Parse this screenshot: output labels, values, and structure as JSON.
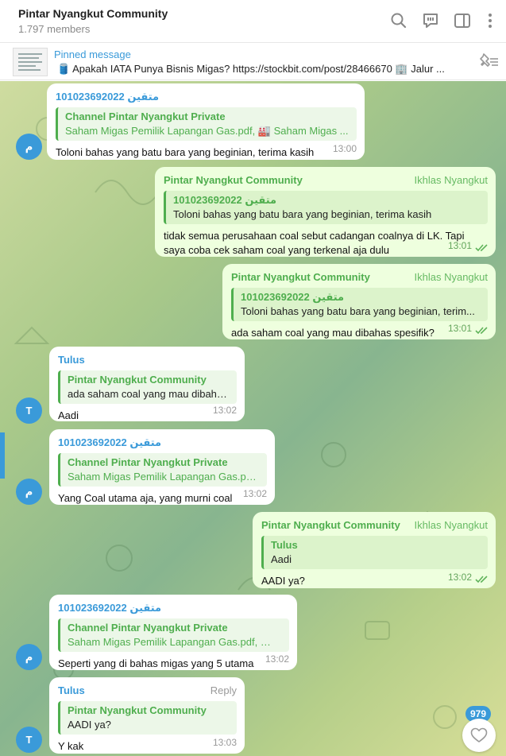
{
  "header": {
    "title": "Pintar Nyangkut Community",
    "members": "1.797 members"
  },
  "pinned": {
    "label": "Pinned message",
    "text": "🛢️ Apakah IATA Punya Bisnis Migas?   https://stockbit.com/post/28466670  🏢 Jalur ..."
  },
  "messages": [
    {
      "sender": "101023692022 متقين",
      "quote_name": "Channel Pintar Nyangkut Private",
      "quote_text": "Saham Migas Pemilik Lapangan Gas.pdf, 🏭 Saham Migas ...",
      "body": "Toloni bahas yang batu bara yang beginian, terima kasih",
      "time": "13:00",
      "avatar": "م"
    },
    {
      "sender": "Pintar Nyangkut Community",
      "signature": "Ikhlas Nyangkut",
      "quote_name": "101023692022 متقين",
      "quote_text": "Toloni bahas yang batu bara yang beginian, terima kasih",
      "body": "tidak semua perusahaan coal sebut cadangan coalnya di LK. Tapi saya coba cek saham coal yang terkenal aja dulu",
      "time": "13:01"
    },
    {
      "sender": "Pintar Nyangkut Community",
      "signature": "Ikhlas Nyangkut",
      "quote_name": "101023692022 متقين",
      "quote_text": "Toloni bahas yang batu bara yang beginian, terim...",
      "body": "ada saham coal yang mau dibahas spesifik?",
      "time": "13:01"
    },
    {
      "sender": "Tulus",
      "quote_name": "Pintar Nyangkut Community",
      "quote_text": "ada saham coal yang mau dibaha...",
      "body": "Aadi",
      "time": "13:02",
      "avatar": "T"
    },
    {
      "sender": "101023692022 متقين",
      "quote_name": "Channel Pintar Nyangkut Private",
      "quote_text": "Saham Migas Pemilik Lapangan Gas.pdf...",
      "body": "Yang Coal utama aja, yang murni coal",
      "time": "13:02",
      "avatar": "م"
    },
    {
      "sender": "Pintar Nyangkut Community",
      "signature": "Ikhlas Nyangkut",
      "quote_name": "Tulus",
      "quote_text": "Aadi",
      "body": "AADI ya?",
      "time": "13:02"
    },
    {
      "sender": "101023692022 متقين",
      "quote_name": "Channel Pintar Nyangkut Private",
      "quote_text": "Saham Migas Pemilik Lapangan Gas.pdf, 🏭 ...",
      "body": "Seperti yang di bahas migas yang 5 utama",
      "time": "13:02",
      "avatar": "م"
    },
    {
      "sender": "Tulus",
      "reply": "Reply",
      "quote_name": "Pintar Nyangkut Community",
      "quote_text": "AADI ya?",
      "body": "Y kak",
      "time": "13:03",
      "avatar": "T"
    }
  ],
  "unread_count": "979",
  "colors": {
    "accent": "#3a9ad9",
    "green": "#4fae4e",
    "outgoing_bubble": "#eeffde"
  },
  "icons": [
    "search-icon",
    "comment-icon",
    "sidebar-icon",
    "more-icon",
    "unpin-icon",
    "heart-icon"
  ]
}
